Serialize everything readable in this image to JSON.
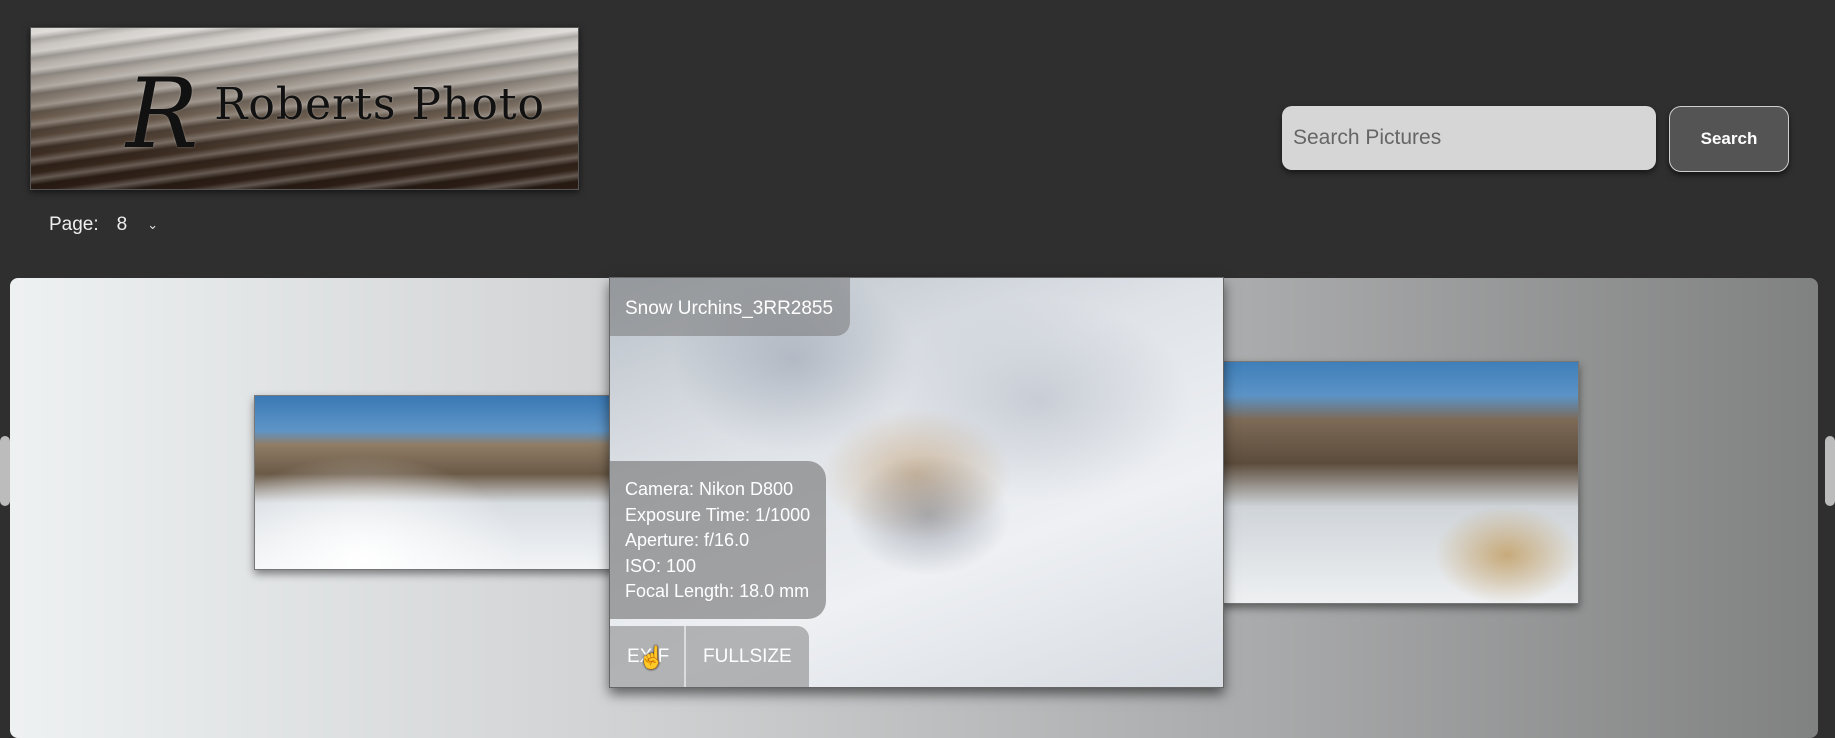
{
  "header": {
    "logo_text_initial": "R",
    "logo_text_rest": "Roberts Photo"
  },
  "pagination": {
    "label": "Page:",
    "selected": "8"
  },
  "search": {
    "placeholder": "Search Pictures",
    "button_label": "Search"
  },
  "gallery": {
    "current_photo": {
      "title": "Snow Urchins_3RR2855",
      "exif": {
        "camera": "Camera: Nikon D800",
        "exposure": "Exposure Time: 1/1000",
        "aperture": "Aperture: f/16.0",
        "iso": "ISO: 100",
        "focal_length": "Focal Length: 18.0 mm"
      },
      "tabs": {
        "exif": "EXIF",
        "fullsize": "FULLSIZE"
      }
    }
  },
  "icons": {
    "chevron": "chevron-down-icon",
    "cursor": "hand-pointer-icon"
  }
}
